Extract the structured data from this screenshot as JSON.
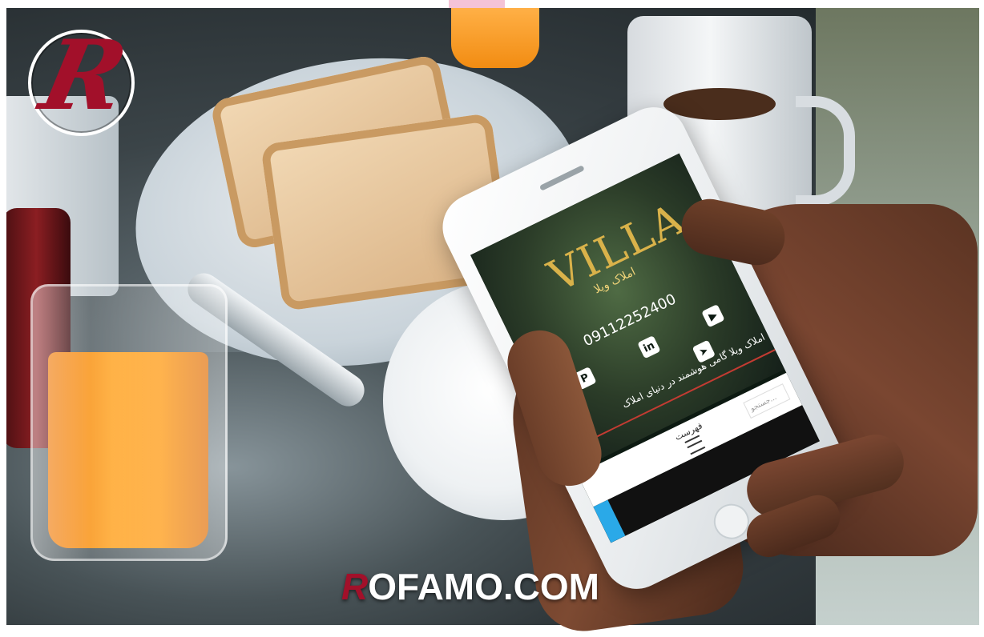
{
  "logo": {
    "letter": "R"
  },
  "phone": {
    "brand_word": "VILLA",
    "brand_subtitle": "املاک ویلا",
    "phone_number": "09112252400",
    "social_icons": [
      "pinterest-icon",
      "linkedin-icon",
      "youtube-icon",
      "instagram-icon",
      "telegram-icon"
    ],
    "tagline": "املاک ویلا گامی هوشمند در دنیای املاک",
    "menu_label": "فهرست",
    "search_placeholder": "جستجو..."
  },
  "watermark": {
    "first_letter": "R",
    "rest": "OFAMO.COM"
  },
  "colors": {
    "brand_red": "#a2102a",
    "gold": "#d9b24a",
    "accent_blue": "#2f93e6"
  }
}
